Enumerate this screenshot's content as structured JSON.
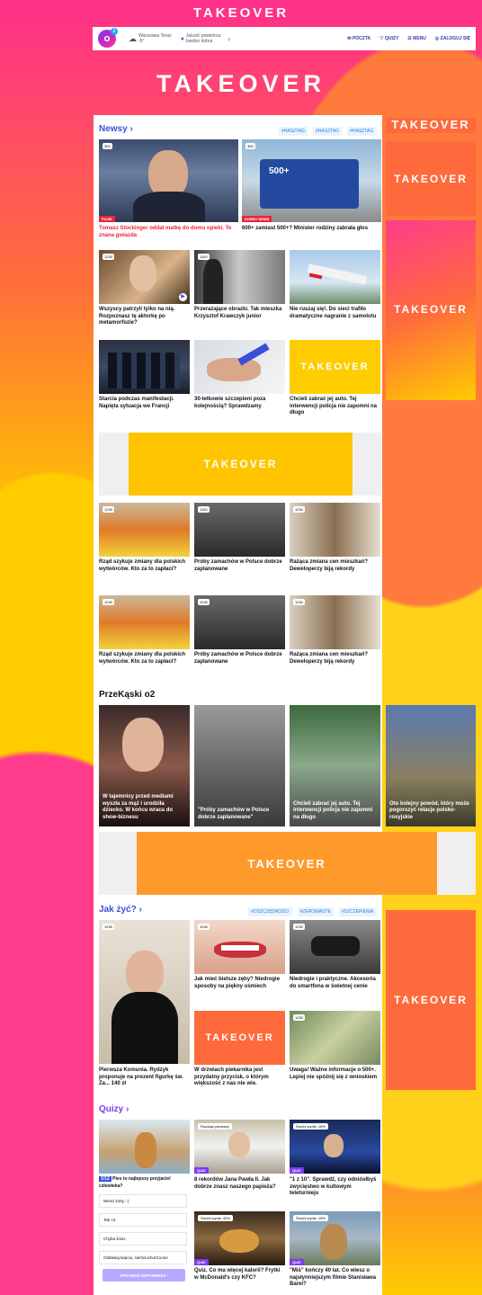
{
  "takeover_label": "TAKEOVER",
  "header": {
    "logo": "o",
    "logo_sup": "2",
    "weather_city": "Warszawa Teraz",
    "weather_temp": "-5°",
    "weather_info": "Jakość powietrza",
    "weather_info2": "bardzo dobra",
    "nav": [
      "POCZTA",
      "QUIZY",
      "MENU",
      "ZALOGUJ SIĘ"
    ]
  },
  "newsy": {
    "title": "Newsy ›",
    "tags": [
      "#HASZTAG",
      "#HASZTAG",
      "#HASZTAG"
    ],
    "top": [
      {
        "badge": "300",
        "label": "PILNE",
        "caption": "Tomasz Stockinger oddał matkę do domu opieki. To znana gwiazda"
      },
      {
        "badge": "300",
        "label": "DOBRY NEWS",
        "caption": "600+ zamiast 500+? Minister rodziny zabrała głos"
      }
    ],
    "grid": [
      {
        "badge": "1230",
        "caption": "Wszyscy patrzyli tylko na nią. Rozpoznasz tę aktorkę po metamorfozie?"
      },
      {
        "badge": "1100",
        "caption": "Przerażające obrazki. Tak mieszka Krzysztof Krawczyk junior"
      },
      {
        "badge": "",
        "caption": "Nie ruszaj się!. Do sieci trafiło dramatyczne nagranie z samolotu"
      },
      {
        "badge": "",
        "caption": "Starcia podczas manifestacji. Napięta sytuacja we Francji"
      },
      {
        "badge": "",
        "caption": "30-letkowie szczepieni poza kolejnością? Sprawdzamy"
      },
      {
        "badge": "",
        "caption": "Chcieli zabrać jej auto. Tej interwencji policja nie zapomni na długo"
      }
    ],
    "grid2": [
      {
        "badge": "1230",
        "caption": "Rząd szykuje zmiany dla polskich wytwórców. Kto za to zapłaci?"
      },
      {
        "badge": "1100",
        "caption": "Próby zamachów w Polsce dobrze zaplanowane"
      },
      {
        "badge": "1230",
        "caption": "Rażąca zmiana cen mieszkań? Deweloperzy biją rekordy"
      },
      {
        "badge": "1230",
        "caption": "Rząd szykuje zmiany dla polskich wytwórców. Kto za to zapłaci?"
      },
      {
        "badge": "1230",
        "caption": "Próby zamachów w Polsce dobrze zaplanowane"
      },
      {
        "badge": "1230",
        "caption": "Rażąca zmiana cen mieszkań? Deweloperzy biją rekordy"
      }
    ]
  },
  "przekaski": {
    "title": "PrzeKąski o2",
    "items": [
      "W tajemnicy przed mediami wyszła za mąż i urodziła dziecko. W końcu wraca do show-biznesu",
      "\"Próby zamachów w Polsce dobrze zaplanowane\"",
      "Chcieli zabrać jej auto. Tej interwencji policja nie zapomni na długo",
      "Oto kolejny powód, który może pogorszyć relacje polsko-rosyjskie"
    ]
  },
  "jakzyc": {
    "title": "Jak żyć? ›",
    "tags": [
      "#OSZCZĘDNOŚCI",
      "#ZEROWASTE",
      "#SZCZEPIENIA"
    ],
    "items": [
      {
        "badge": "1230",
        "caption": "Pierwsza Komunia. Rydzyk proponuje na prezent figurkę św. Za... 140 zł"
      },
      {
        "badge": "1230",
        "caption": "Jak mieć bielsze zęby? Niedrogie sposoby na piękny uśmiech"
      },
      {
        "badge": "1230",
        "caption": "Niedrogie i praktyczne. Akcesoria do smartfona w świetnej cenie"
      },
      {
        "badge": "",
        "caption": "W drzwiach piekarnika jest przydatny przycisk, o którym większość z nas nie wie."
      },
      {
        "badge": "1230",
        "caption": "Uwaga! Ważne informacje o 500+. Lepiej nie spóźnij się z wnioskiem"
      }
    ]
  },
  "quizy": {
    "title": "Quizy ›",
    "question_num": "1/12",
    "question": "Pies to najlepszy przyjaciel człowieka?",
    "options": [
      "Wiesz kotty ;-)",
      "Tak <3",
      "Chyba śnisz.",
      "Oddawaj kapcia, sierściuchu!!11one"
    ],
    "submit": "SPRAWDŹ ODPOWIEDŹ ›",
    "items": [
      {
        "score": "Rozwiąż pierwszy",
        "pill": "QUIZ",
        "caption": "8 rekordów Jana Pawła II. Jak dobrze znasz naszego papieża?"
      },
      {
        "score": "Średni wynik: 16%",
        "pill": "QUIZ",
        "caption": "\"1 z 10\". Sprawdź, czy odniósłbyś zwycięstwo w kultowym teleturnieju"
      },
      {
        "score": "Średni wynik: 45%",
        "pill": "QUIZ",
        "caption": "Quiz. Co ma więcej kalorii? Frytki w McDonald's czy KFC?"
      },
      {
        "score": "Średni wynik: 15%",
        "pill": "QUIZ",
        "caption": "\"Miś\" kończy 40 lat. Co wiesz o najsłynniejszym filmie Stanisława Barei?"
      }
    ]
  }
}
